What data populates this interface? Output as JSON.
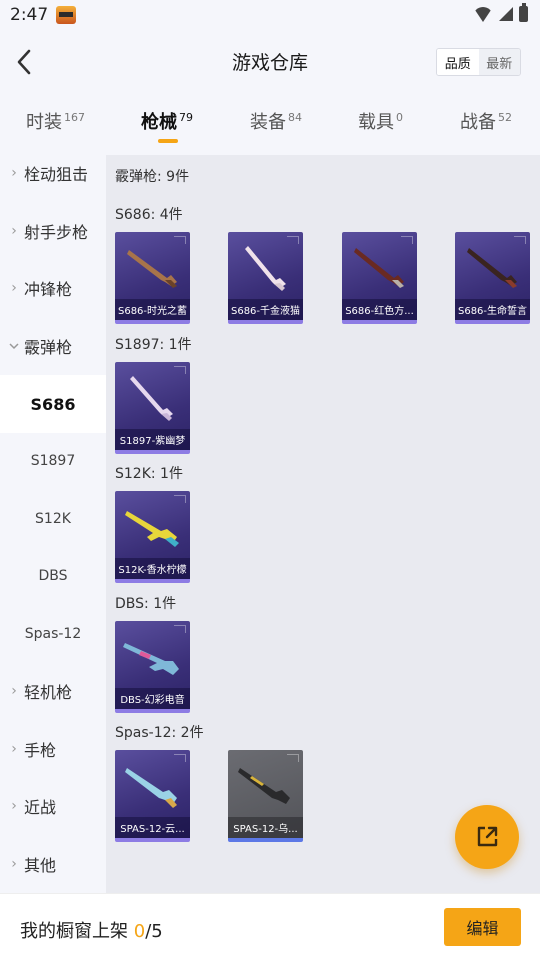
{
  "status_bar": {
    "time": "2:47"
  },
  "header": {
    "title": "游戏仓库",
    "sort_options": [
      "品质",
      "最新"
    ],
    "active_sort": "品质"
  },
  "tabs": [
    {
      "label": "时装",
      "count": "167"
    },
    {
      "label": "枪械",
      "count": "79",
      "active": true
    },
    {
      "label": "装备",
      "count": "84"
    },
    {
      "label": "载具",
      "count": "0"
    },
    {
      "label": "战备",
      "count": "52"
    }
  ],
  "sidebar": {
    "categories": [
      "栓动狙击",
      "射手步枪",
      "冲锋枪",
      "霰弹枪",
      "轻机枪",
      "手枪",
      "近战",
      "其他"
    ],
    "subcategories": [
      "S686",
      "S1897",
      "S12K",
      "DBS",
      "Spas-12"
    ],
    "active_sub": "S686"
  },
  "content": {
    "summary": "霰弹枪: 9件",
    "groups": [
      {
        "label": "S686: 4件",
        "items": [
          "S686-时光之蓄",
          "S686-千金液猫",
          "S686-红色方...",
          "S686-生命誓言"
        ]
      },
      {
        "label": "S1897: 1件",
        "items": [
          "S1897-紫幽梦"
        ]
      },
      {
        "label": "S12K: 1件",
        "items": [
          "S12K-香水柠檬"
        ]
      },
      {
        "label": "DBS: 1件",
        "items": [
          "DBS-幻彩电音"
        ]
      },
      {
        "label": "Spas-12: 2件",
        "items": [
          "SPAS-12-云...",
          "SPAS-12-乌..."
        ]
      }
    ]
  },
  "bottom_bar": {
    "shelf_label": "我的橱窗上架",
    "shelf_current": "0",
    "shelf_total": "/5",
    "edit_label": "编辑"
  },
  "icons": {
    "back": "chevron-left-icon",
    "share": "external-link-icon",
    "expand": "chevron-right-icon",
    "collapse": "chevron-down-icon"
  },
  "colors": {
    "accent": "#f5a516",
    "card_purple": "#3a2f78",
    "card_grey": "#525358"
  }
}
